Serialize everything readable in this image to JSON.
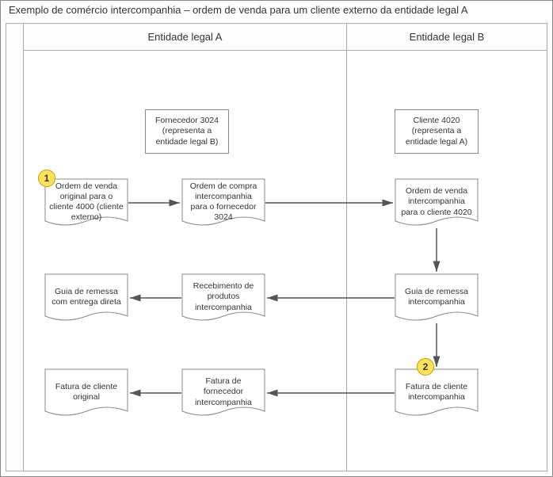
{
  "title": "Exemplo de comércio intercompanhia – ordem de venda para um cliente externo da entidade legal A",
  "columns": {
    "a": "Entidade legal A",
    "b": "Entidade legal B"
  },
  "nodes": {
    "fornecedor": "Fornecedor 3024 (representa a entidade legal B)",
    "cliente": "Cliente 4020 (representa a entidade legal A)",
    "ordemVendaOriginal": "Ordem de venda original para o cliente 4000 (cliente externo)",
    "ordemCompraInter": "Ordem de compra intercompanhia para o fornecedor 3024",
    "ordemVendaInter": "Ordem de venda intercompanhia para o cliente 4020",
    "guiaRemessaDireta": "Guia de remessa com entrega direta",
    "recebimentoProdutos": "Recebimento de produtos intercompanhia",
    "guiaRemessaInter": "Guia de remessa intercompanhia",
    "faturaClienteOriginal": "Fatura de cliente original",
    "faturaFornecedorInter": "Fatura de fornecedor intercompanhia",
    "faturaClienteInter": "Fatura de cliente intercompanhia"
  },
  "badges": {
    "b1": "1",
    "b2": "2"
  }
}
